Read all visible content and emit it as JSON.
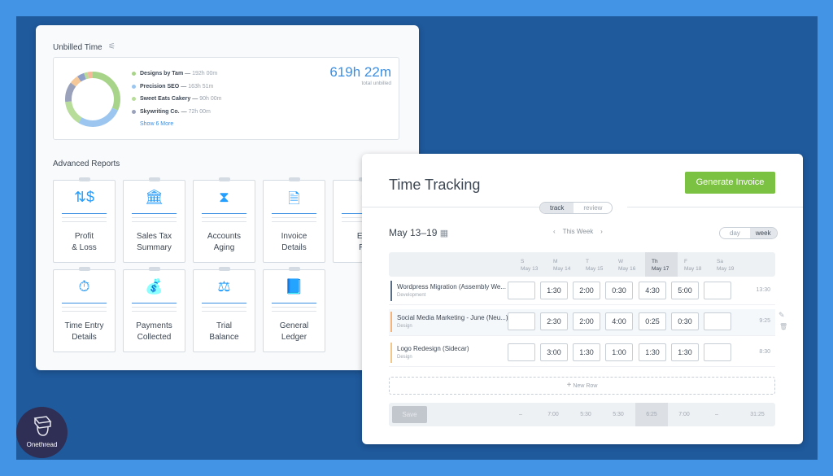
{
  "unbilled": {
    "title": "Unbilled Time",
    "total": "619h 22m",
    "total_label": "total unbilled",
    "show_more": "Show 6 More",
    "clients": [
      {
        "name": "Designs by Tam",
        "time": "192h 00m",
        "color": "#a8d48a"
      },
      {
        "name": "Precision SEO",
        "time": "163h 51m",
        "color": "#9cc6f0"
      },
      {
        "name": "Sweet Eats Cakery",
        "time": "90h 00m",
        "color": "#b8dc9a"
      },
      {
        "name": "Skywriting Co.",
        "time": "72h 00m",
        "color": "#9aa2bb"
      }
    ]
  },
  "reports": {
    "title": "Advanced Reports",
    "items": [
      {
        "l1": "Profit",
        "l2": "& Loss",
        "icon": "money-arrows-icon"
      },
      {
        "l1": "Sales Tax",
        "l2": "Summary",
        "icon": "bank-icon"
      },
      {
        "l1": "Accounts",
        "l2": "Aging",
        "icon": "hourglass-icon"
      },
      {
        "l1": "Invoice",
        "l2": "Details",
        "icon": "document-search-icon"
      },
      {
        "l1": "Exp",
        "l2": "Re",
        "icon": "expense-icon"
      },
      {
        "l1": "Time Entry",
        "l2": "Details",
        "icon": "stopwatch-icon"
      },
      {
        "l1": "Payments",
        "l2": "Collected",
        "icon": "money-bag-icon"
      },
      {
        "l1": "Trial",
        "l2": "Balance",
        "icon": "scales-icon"
      },
      {
        "l1": "General",
        "l2": "Ledger",
        "icon": "ledger-book-icon"
      }
    ]
  },
  "tracking": {
    "title": "Time Tracking",
    "generate": "Generate Invoice",
    "modes": [
      "track",
      "review"
    ],
    "range": "May 13–19",
    "week_label": "This Week",
    "views": [
      "day",
      "week"
    ],
    "days": [
      {
        "d": "S",
        "date": "May 13"
      },
      {
        "d": "M",
        "date": "May 14"
      },
      {
        "d": "T",
        "date": "May 15"
      },
      {
        "d": "W",
        "date": "May 16"
      },
      {
        "d": "Th",
        "date": "May 17"
      },
      {
        "d": "F",
        "date": "May 18"
      },
      {
        "d": "Sa",
        "date": "May 19"
      }
    ],
    "rows": [
      {
        "name": "Wordpress Migration (Assembly We...",
        "sub": "Development",
        "color": "#5a6d86",
        "cells": [
          "",
          "1:30",
          "2:00",
          "0:30",
          "4:30",
          "5:00",
          ""
        ],
        "total": "13:30"
      },
      {
        "name": "Social Media Marketing - June (Neu...)",
        "sub": "Design",
        "color": "#f2b47a",
        "cells": [
          "",
          "2:30",
          "2:00",
          "4:00",
          "0:25",
          "0:30",
          ""
        ],
        "total": "9:25"
      },
      {
        "name": "Logo Redesign (Sidecar)",
        "sub": "Design",
        "color": "#f2c88a",
        "cells": [
          "",
          "3:00",
          "1:30",
          "1:00",
          "1:30",
          "1:30",
          ""
        ],
        "total": "8:30"
      }
    ],
    "new_row": "New Row",
    "save": "Save",
    "footer": [
      "–",
      "7:00",
      "5:30",
      "5:30",
      "6:25",
      "7:00",
      "–"
    ],
    "footer_total": "31:25"
  },
  "brand": {
    "name": "Onethread"
  }
}
